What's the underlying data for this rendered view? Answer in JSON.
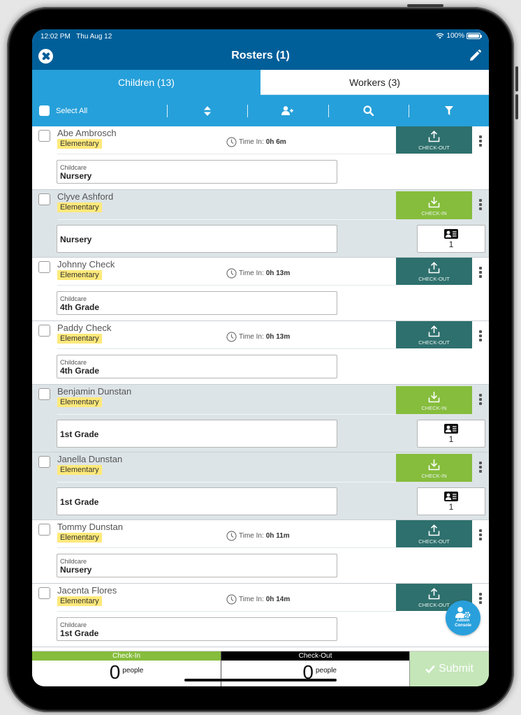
{
  "status_bar": {
    "time": "12:02 PM",
    "date": "Thu Aug 12",
    "battery": "100%",
    "wifi_icon": "wifi-icon",
    "battery_icon": "battery-full-icon"
  },
  "nav": {
    "title": "Rosters (1)",
    "close_icon": "close-circle-icon",
    "edit_icon": "pencil-icon"
  },
  "tabs": [
    {
      "label": "Children (13)",
      "active": true
    },
    {
      "label": "Workers (3)",
      "active": false
    }
  ],
  "toolbar": {
    "select_all_label": "Select All",
    "icons": [
      "sort-icon",
      "add-person-icon",
      "search-icon",
      "filter-icon"
    ]
  },
  "colors": {
    "nav_blue": "#005f99",
    "toolbar_blue": "#26a0da",
    "checkout_teal": "#2e706d",
    "checkin_green": "#86bd3c",
    "badge_yellow": "#ffe97a",
    "submit_disabled": "#c4e6b8",
    "checked_in_row_bg": "#dde4e7"
  },
  "roster": [
    {
      "name": "Abe Ambrosch",
      "group": "Elementary",
      "state": "out",
      "time_label": "Time In:",
      "time_value": "0h 6m",
      "action_label": "CHECK-OUT",
      "room_label": "Childcare",
      "room": "Nursery"
    },
    {
      "name": "Clyve Ashford",
      "group": "Elementary",
      "state": "in",
      "action_label": "CHECK-IN",
      "room": "Nursery",
      "tag_count": "1"
    },
    {
      "name": "Johnny Check",
      "group": "Elementary",
      "state": "out",
      "time_label": "Time In:",
      "time_value": "0h 13m",
      "action_label": "CHECK-OUT",
      "room_label": "Childcare",
      "room": "4th Grade"
    },
    {
      "name": "Paddy Check",
      "group": "Elementary",
      "state": "out",
      "time_label": "Time In:",
      "time_value": "0h 13m",
      "action_label": "CHECK-OUT",
      "room_label": "Childcare",
      "room": "4th Grade"
    },
    {
      "name": "Benjamin Dunstan",
      "group": "Elementary",
      "state": "in",
      "action_label": "CHECK-IN",
      "room": "1st Grade",
      "tag_count": "1"
    },
    {
      "name": "Janella Dunstan",
      "group": "Elementary",
      "state": "in",
      "action_label": "CHECK-IN",
      "room": "1st Grade",
      "tag_count": "1"
    },
    {
      "name": "Tommy Dunstan",
      "group": "Elementary",
      "state": "out",
      "time_label": "Time In:",
      "time_value": "0h 11m",
      "action_label": "CHECK-OUT",
      "room_label": "Childcare",
      "room": "Nursery"
    },
    {
      "name": "Jacenta Flores",
      "group": "Elementary",
      "state": "out",
      "time_label": "Time In:",
      "time_value": "0h 14m",
      "action_label": "CHECK-OUT",
      "room_label": "Childcare",
      "room": "1st Grade"
    }
  ],
  "fab": {
    "label_line1": "Admin",
    "label_line2": "Console",
    "icon": "admin-settings-icon"
  },
  "footer": {
    "checkin_label": "Check-In",
    "checkin_count": "0",
    "checkin_unit": "people",
    "checkout_label": "Check-Out",
    "checkout_count": "0",
    "checkout_unit": "people",
    "submit_label": "Submit",
    "submit_enabled": false
  }
}
